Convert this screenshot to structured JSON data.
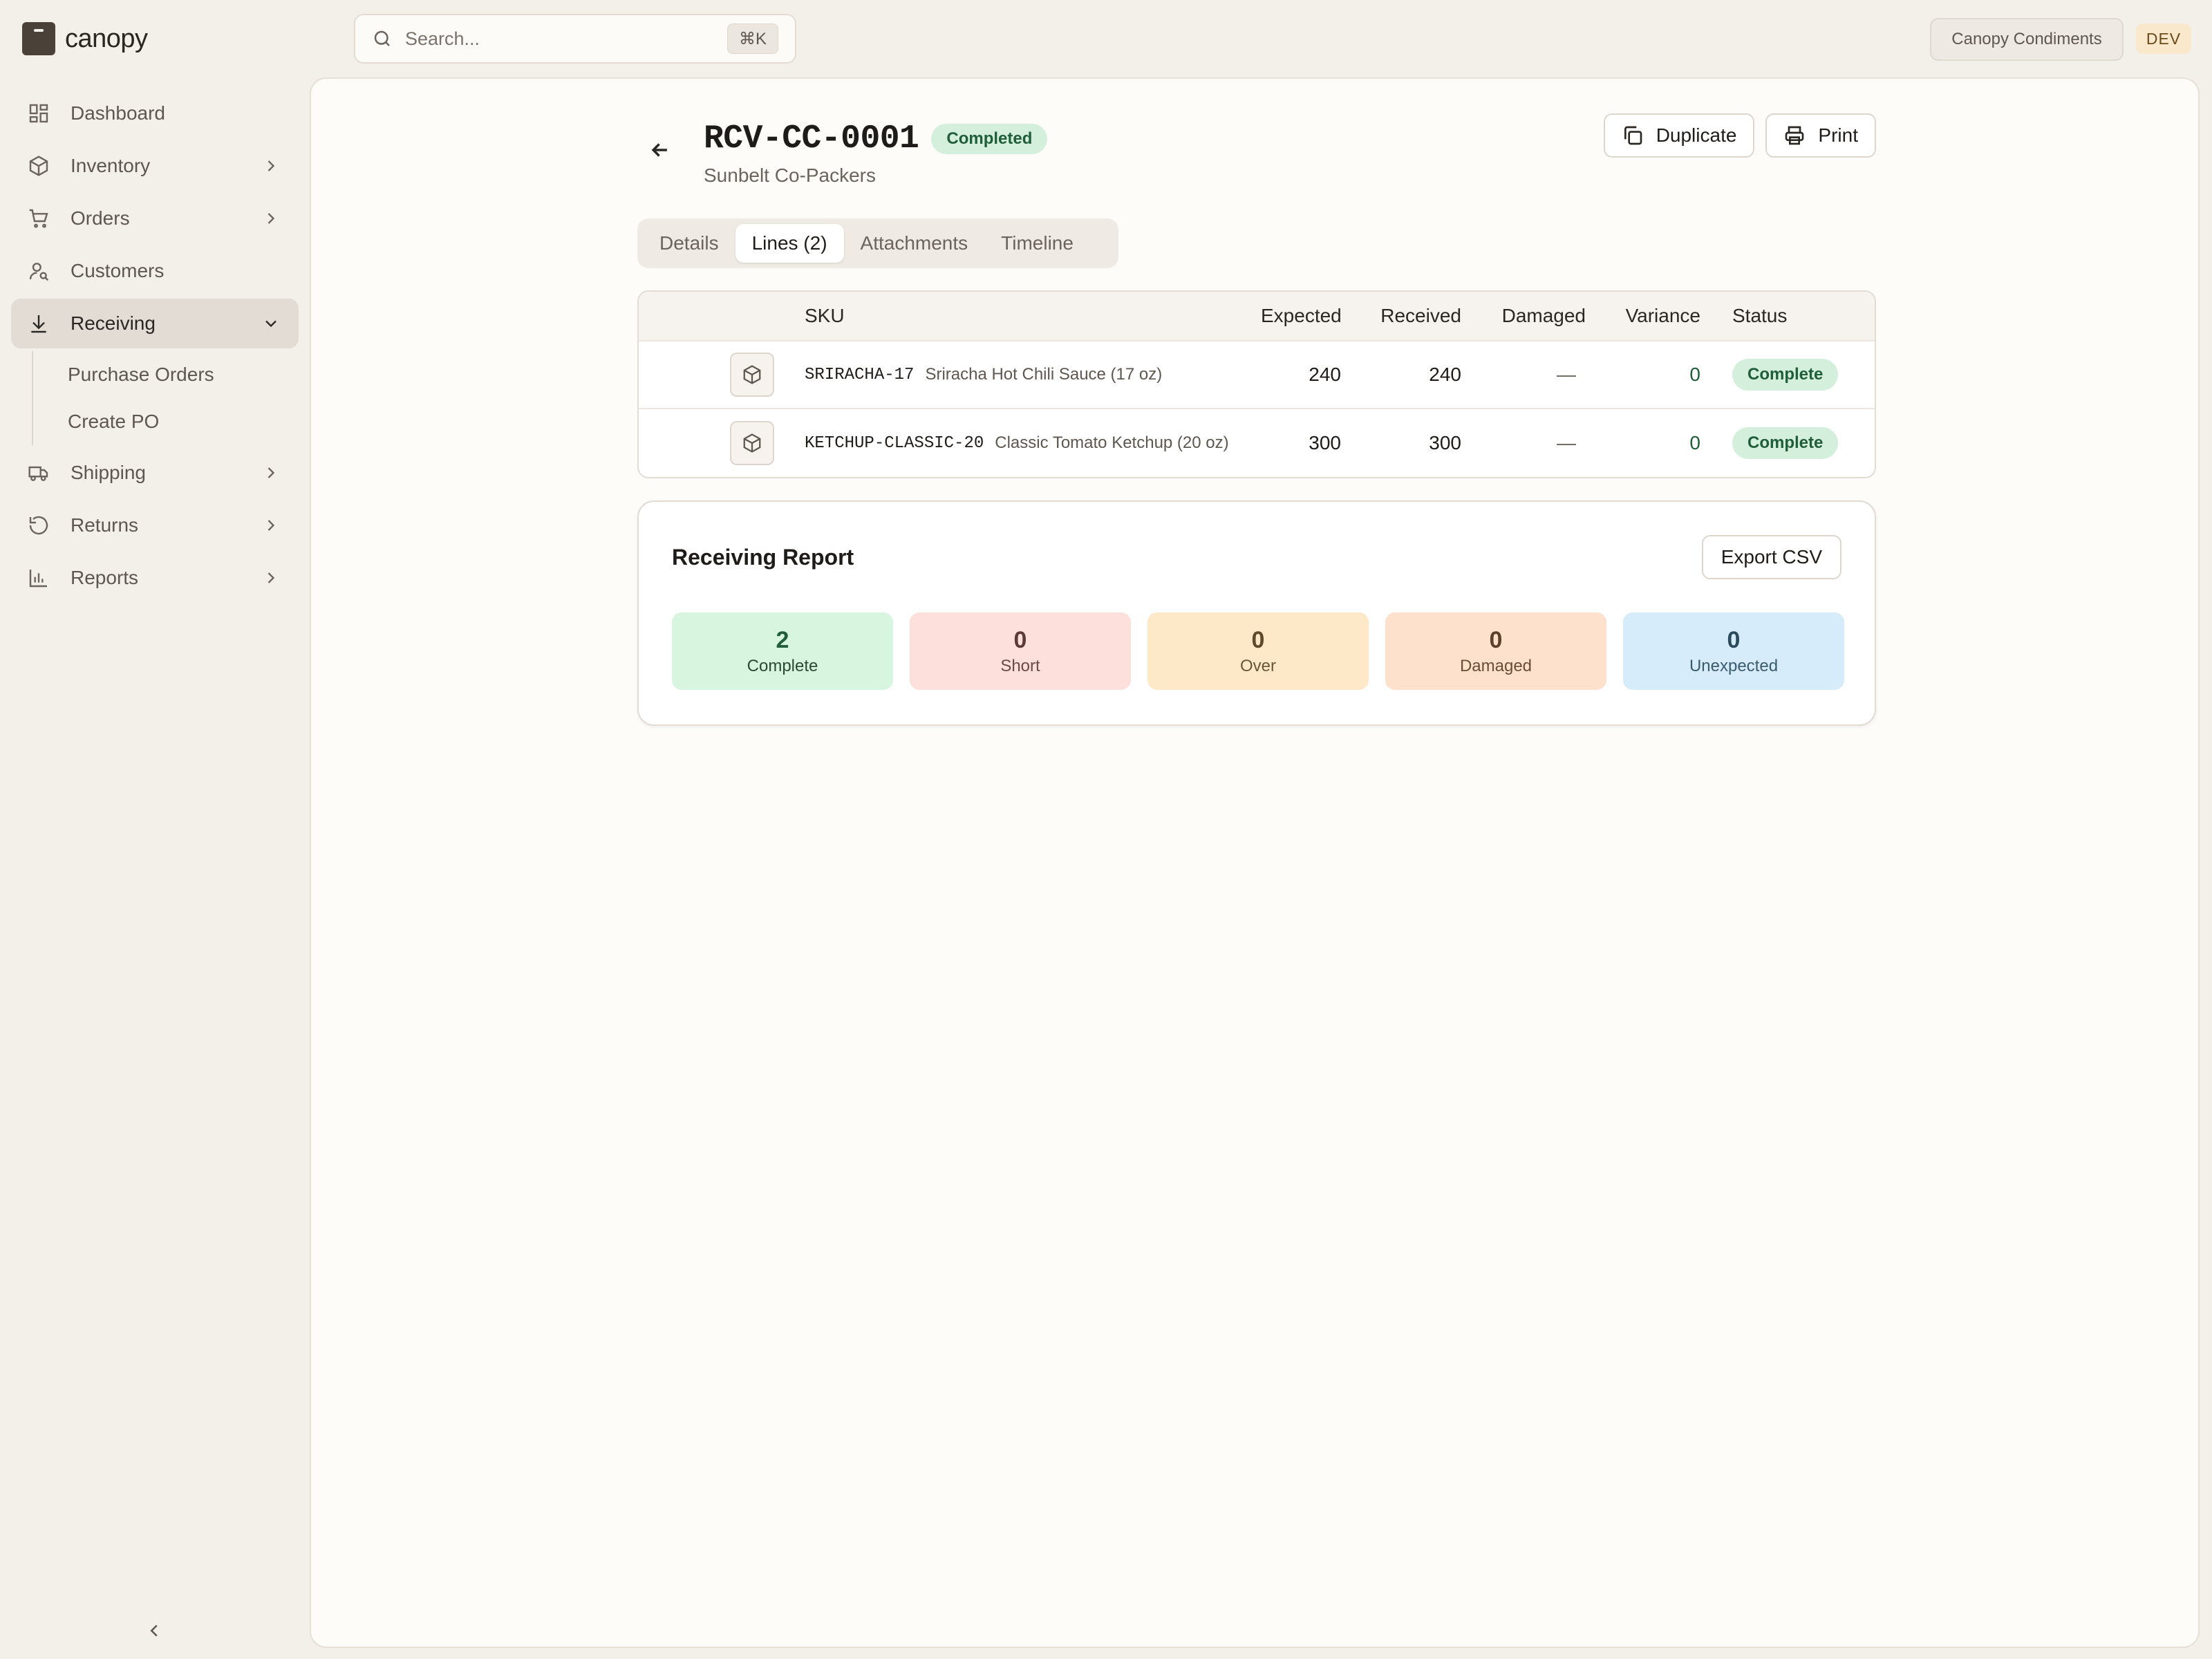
{
  "app": {
    "name": "canopy"
  },
  "sidebar": {
    "items": [
      {
        "label": "Dashboard",
        "icon": "dashboard-icon"
      },
      {
        "label": "Inventory",
        "icon": "box-icon"
      },
      {
        "label": "Orders",
        "icon": "cart-icon"
      },
      {
        "label": "Customers",
        "icon": "customers-icon"
      },
      {
        "label": "Receiving",
        "icon": "download-icon",
        "active": true
      },
      {
        "label": "Shipping",
        "icon": "truck-icon"
      },
      {
        "label": "Returns",
        "icon": "returns-icon"
      },
      {
        "label": "Reports",
        "icon": "chart-icon"
      }
    ],
    "receiving_sub": [
      {
        "label": "Purchase Orders"
      },
      {
        "label": "Create PO"
      }
    ]
  },
  "topbar": {
    "search_placeholder": "Search...",
    "shortcut": "⌘K",
    "org": "Canopy Condiments",
    "env": "DEV"
  },
  "page": {
    "title": "RCV-CC-0001",
    "status": "Completed",
    "subtitle": "Sunbelt Co-Packers",
    "duplicate_label": "Duplicate",
    "print_label": "Print"
  },
  "tabs": [
    {
      "label": "Details"
    },
    {
      "label": "Lines (2)",
      "active": true
    },
    {
      "label": "Attachments"
    },
    {
      "label": "Timeline"
    }
  ],
  "lines": {
    "headers": {
      "sku": "SKU",
      "expected": "Expected",
      "received": "Received",
      "damaged": "Damaged",
      "variance": "Variance",
      "status": "Status"
    },
    "rows": [
      {
        "sku": "SRIRACHA-17",
        "name": "Sriracha Hot Chili Sauce (17 oz)",
        "expected": "240",
        "received": "240",
        "damaged": "—",
        "variance": "0",
        "status": "Complete"
      },
      {
        "sku": "KETCHUP-CLASSIC-20",
        "name": "Classic Tomato Ketchup (20 oz)",
        "expected": "300",
        "received": "300",
        "damaged": "—",
        "variance": "0",
        "status": "Complete"
      }
    ]
  },
  "report": {
    "title": "Receiving Report",
    "export_label": "Export CSV",
    "stats": [
      {
        "value": "2",
        "label": "Complete"
      },
      {
        "value": "0",
        "label": "Short"
      },
      {
        "value": "0",
        "label": "Over"
      },
      {
        "value": "0",
        "label": "Damaged"
      },
      {
        "value": "0",
        "label": "Unexpected"
      }
    ]
  },
  "colors": {
    "accent_complete": "#d4f0dc",
    "short": "#fde0dc",
    "over": "#fde9c8",
    "damaged": "#fde1cc",
    "unexpected": "#d7ecfa"
  }
}
